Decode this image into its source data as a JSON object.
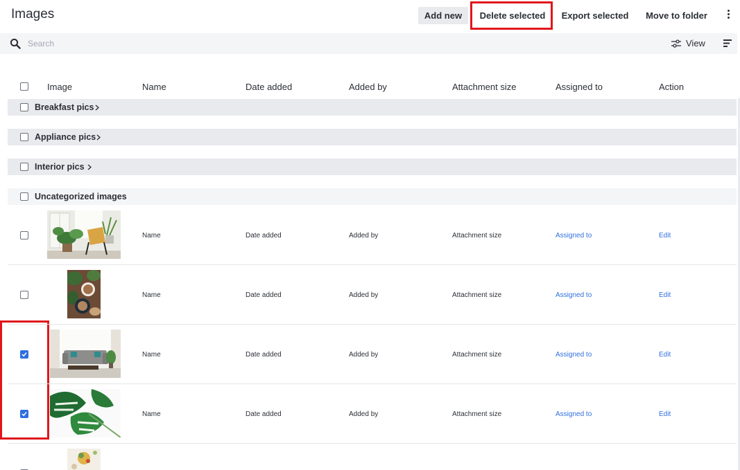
{
  "header": {
    "title": "Images",
    "buttons": {
      "add_new": "Add new",
      "delete_selected": "Delete selected",
      "export_selected": "Export selected",
      "move_to_folder": "Move to folder"
    }
  },
  "search": {
    "placeholder": "Search",
    "value": ""
  },
  "toolbar": {
    "view_label": "View"
  },
  "columns": {
    "image": "Image",
    "name": "Name",
    "date_added": "Date added",
    "added_by": "Added by",
    "attachment_size": "Attachment size",
    "assigned_to": "Assigned to",
    "action": "Action"
  },
  "groups": [
    {
      "label": "Breakfast pics",
      "expandable": true,
      "checked": false
    },
    {
      "label": "Appliance pics",
      "expandable": true,
      "checked": false
    },
    {
      "label": "Interior pics",
      "expandable": true,
      "checked": false
    },
    {
      "label": "Uncategorized images",
      "expandable": false,
      "checked": false
    }
  ],
  "rows": [
    {
      "image": "plants-chair-photo",
      "name": "Name",
      "date_added": "Date added",
      "added_by": "Added by",
      "attachment_size": "Attachment size",
      "assigned_to": "Assigned to",
      "action": "Edit",
      "checked": false
    },
    {
      "image": "coffee-cups-photo",
      "name": "Name",
      "date_added": "Date added",
      "added_by": "Added by",
      "attachment_size": "Attachment size",
      "assigned_to": "Assigned to",
      "action": "Edit",
      "checked": false
    },
    {
      "image": "sofa-living-room-photo",
      "name": "Name",
      "date_added": "Date added",
      "added_by": "Added by",
      "attachment_size": "Attachment size",
      "assigned_to": "Assigned to",
      "action": "Edit",
      "checked": true
    },
    {
      "image": "monstera-leaves-photo",
      "name": "Name",
      "date_added": "Date added",
      "added_by": "Added by",
      "attachment_size": "Attachment size",
      "assigned_to": "Assigned to",
      "action": "Edit",
      "checked": true
    },
    {
      "image": "food-bowl-photo",
      "checked": false
    }
  ],
  "colors": {
    "highlight": "#e0161b",
    "link": "#2f6fde",
    "checkbox_checked": "#2f6fde",
    "group_bg": "#e8eaee",
    "toolbar_bg": "#f4f5f7"
  }
}
